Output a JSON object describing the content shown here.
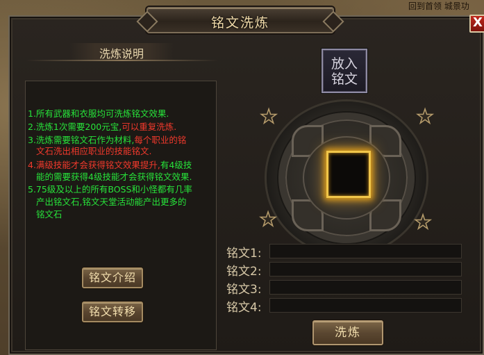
{
  "background": {
    "top_right_text": "回到首领 城景功"
  },
  "window": {
    "title": "铭文洗炼",
    "close_label": "X"
  },
  "description": {
    "header": "洗炼说明",
    "lines": [
      {
        "text": "1.所有武器和衣服均可洗炼铭文效果.",
        "color": "green"
      },
      {
        "text": "2.洗炼1次需要200元宝,",
        "color": "green"
      },
      {
        "text": "可以重复洗炼.",
        "color": "red"
      },
      {
        "text": "3.洗炼需要铭文石作为材料,",
        "color": "green"
      },
      {
        "text": "每个职业的铭",
        "color": "red"
      },
      {
        "text": "文石洗出相应职业的技能铭文.",
        "color": "red"
      },
      {
        "text": "4.满级技能才会获得铭文效果提升,",
        "color": "red"
      },
      {
        "text": "有4级技",
        "color": "green"
      },
      {
        "text": "能的需要获得4级技能才会获得铭文效果.",
        "color": "green"
      },
      {
        "text": "5.75级及以上的所有BOSS和小怪都有几率",
        "color": "green"
      },
      {
        "text": "产出铭文石,铭文天堂活动能产出更多的",
        "color": "green"
      },
      {
        "text": "铭文石",
        "color": "green"
      }
    ]
  },
  "buttons": {
    "intro": "铭文介绍",
    "transfer": "铭文转移",
    "refine": "洗炼",
    "insert_line1": "放入",
    "insert_line2": "铭文"
  },
  "inscriptions": [
    {
      "label": "铭文1:",
      "value": ""
    },
    {
      "label": "铭文2:",
      "value": ""
    },
    {
      "label": "铭文3:",
      "value": ""
    },
    {
      "label": "铭文4:",
      "value": ""
    }
  ],
  "colors": {
    "rule_green": "#27e33a",
    "rule_red": "#f2392c",
    "slot_glow": "#f1c64a",
    "title_text": "#efd9a8"
  },
  "icons": [
    "star-icon",
    "close-icon"
  ]
}
